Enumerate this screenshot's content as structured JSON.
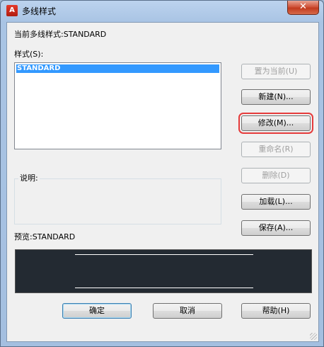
{
  "window": {
    "title": "多线样式",
    "close_glyph": "✕",
    "icon_letter": "A"
  },
  "current_style": {
    "label": "当前多线样式:STANDARD"
  },
  "styles": {
    "label": "样式(S):",
    "items": [
      "STANDARD"
    ],
    "selected": "STANDARD"
  },
  "buttons": {
    "set_current": "置为当前(U)",
    "new": "新建(N)...",
    "modify": "修改(M)...",
    "rename": "重命名(R)",
    "delete": "删除(D)",
    "load": "加载(L)...",
    "save": "保存(A)..."
  },
  "description": {
    "label": "说明:"
  },
  "preview": {
    "label": "预览:STANDARD"
  },
  "footer": {
    "ok": "确定",
    "cancel": "取消",
    "help": "帮助(H)"
  },
  "colors": {
    "highlight_box": "#e53b3b",
    "selection": "#3399ff",
    "preview_bg": "#232a32"
  }
}
